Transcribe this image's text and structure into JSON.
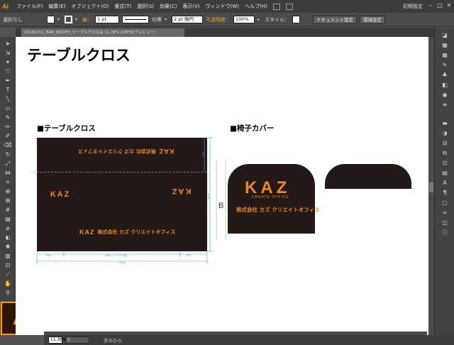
{
  "app": {
    "logo": "Ai",
    "big_logo": "Ai"
  },
  "menu": {
    "items": [
      "ファイル(F)",
      "編集(E)",
      "オブジェクト(O)",
      "書式(T)",
      "選択(S)",
      "効果(C)",
      "表示(V)",
      "ウィンドウ(W)",
      "ヘルプ(H)"
    ],
    "workspace": "初期設定"
  },
  "control_bar": {
    "selection": "選択なし",
    "stroke_label": "線：",
    "stroke_weight": "1 pt",
    "stroke_profile": "均等",
    "brush": "2 pt 楕円",
    "opacity_label": "不透明度：",
    "opacity": "100%",
    "style_label": "スタイル：",
    "doc_setup": "ドキュメント設定",
    "prefs": "環境設定"
  },
  "doc_tab": {
    "name": "20161011_BAN_BOOTH_テーブルクロス@ 11.36% (CMYK/プレビュー)"
  },
  "canvas": {
    "title": "テーブルクロス",
    "section1": "■テーブルクロス",
    "section2": "■椅子カバー",
    "b_label": "B",
    "kaz": "KAZ",
    "create_office": "CREATE OFFICE",
    "company": "株式会社 カズ クリエイトオフィス",
    "dims": {
      "total": "3200",
      "mid": "1800（テーブル幅）",
      "side": "700",
      "height": "2000",
      "top": "700"
    }
  },
  "status": {
    "zoom": "11.36%",
    "page": "1",
    "tool": "手のひら"
  },
  "colors": {
    "cloth": "#241917",
    "logo_orange": "#e58a2c",
    "ai_orange": "#ff9a00"
  }
}
